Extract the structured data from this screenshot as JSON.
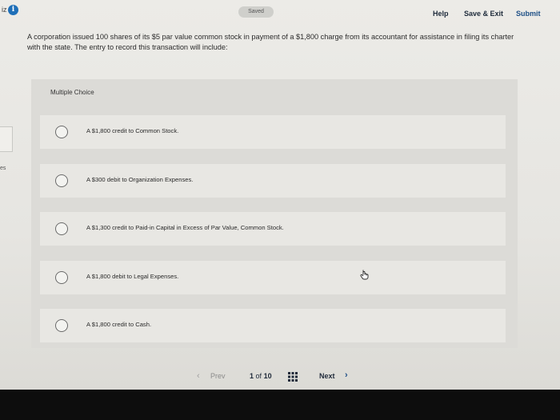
{
  "header": {
    "quiz_label": "iz",
    "saved_label": "Saved",
    "help_label": "Help",
    "save_exit_label": "Save & Exit",
    "submit_label": "Submit"
  },
  "question": {
    "text": "A corporation issued 100 shares of its $5 par value common stock in payment of a $1,800 charge from its accountant for assistance in filing its charter with the state. The entry to record this transaction will include:"
  },
  "side": {
    "fragment_label": "es"
  },
  "multiple_choice": {
    "title": "Multiple Choice",
    "options": [
      {
        "label": "A $1,800 credit to Common Stock."
      },
      {
        "label": "A $300 debit to Organization Expenses."
      },
      {
        "label": "A $1,300 credit to Paid-in Capital in Excess of Par Value, Common Stock."
      },
      {
        "label": "A $1,800 debit to Legal Expenses."
      },
      {
        "label": "A $1,800 credit to Cash."
      }
    ]
  },
  "navigation": {
    "prev_label": "Prev",
    "current_page": "1",
    "of_label": "of",
    "total_pages": "10",
    "next_label": "Next"
  },
  "icons": {
    "info": "info-icon",
    "grid": "grid-icon",
    "prev": "chevron-left-icon",
    "next": "chevron-right-icon",
    "cursor": "hand-cursor-icon"
  },
  "colors": {
    "accent": "#1e4f86",
    "info_icon": "#1f6fb8"
  }
}
